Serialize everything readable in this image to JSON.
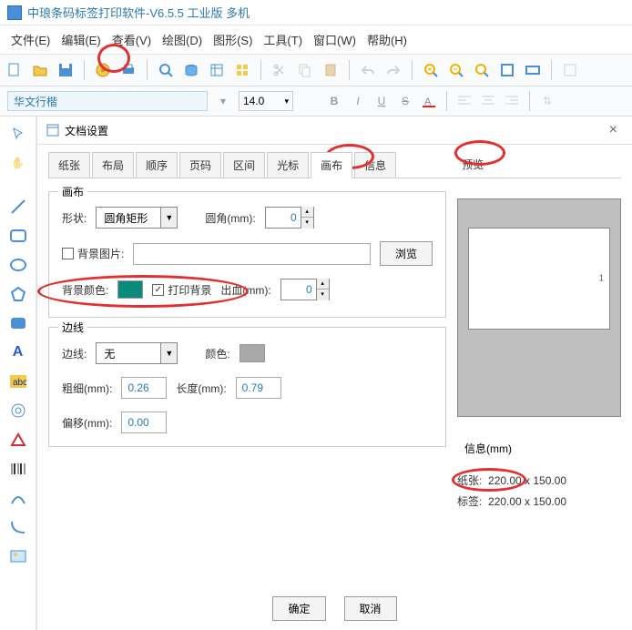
{
  "window_title": "中琅条码标签打印软件-V6.5.5 工业版 多机",
  "menus": [
    "文件(E)",
    "编辑(E)",
    "查看(V)",
    "绘图(D)",
    "图形(S)",
    "工具(T)",
    "窗口(W)",
    "帮助(H)"
  ],
  "font_name": "华文行楷",
  "font_size": "14.0",
  "fmt": {
    "b": "B",
    "i": "I",
    "u": "U",
    "s": "S"
  },
  "dialog": {
    "title": "文档设置",
    "tabs": [
      "纸张",
      "布局",
      "顺序",
      "页码",
      "区间",
      "光标",
      "画布",
      "信息"
    ],
    "active_tab_index": 6,
    "preview_label": "预览",
    "canvas_group": "画布",
    "shape_label": "形状:",
    "shape_value": "圆角矩形",
    "corner_label": "圆角(mm):",
    "corner_value": "0",
    "bgimg_label": "背景图片:",
    "browse": "浏览",
    "bgcolor_label": "背景颜色:",
    "bgcolor_value": "#0a8a7a",
    "printbg_label": "打印背景",
    "bleed_label": "出血(mm):",
    "bleed_value": "0",
    "border_group": "边线",
    "border_label": "边线:",
    "border_value": "无",
    "color_label": "颜色:",
    "border_color": "#a8a8a8",
    "thick_label": "粗细(mm):",
    "thick_value": "0.26",
    "length_label": "长度(mm):",
    "length_value": "0.79",
    "offset_label": "偏移(mm):",
    "offset_value": "0.00",
    "info_title": "信息(mm)",
    "paper_label": "纸张:",
    "paper_size": "220.00 x 150.00",
    "label_label": "标签:",
    "label_size": "220.00 x 150.00",
    "ok": "确定",
    "cancel": "取消"
  }
}
